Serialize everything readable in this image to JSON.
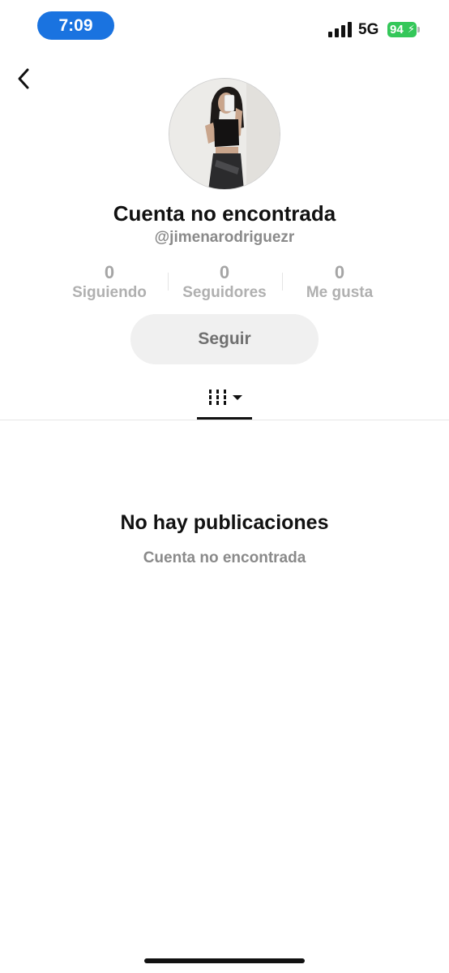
{
  "status_bar": {
    "time": "7:09",
    "network": "5G",
    "battery": "94",
    "accent_color": "#1a73e0",
    "battery_color": "#34c759"
  },
  "profile": {
    "title": "Cuenta no encontrada",
    "username": "@jimenarodriguezr",
    "stats": [
      {
        "value": "0",
        "label": "Siguiendo"
      },
      {
        "value": "0",
        "label": "Seguidores"
      },
      {
        "value": "0",
        "label": "Me gusta"
      }
    ],
    "follow_label": "Seguir"
  },
  "empty_state": {
    "title": "No hay publicaciones",
    "subtitle": "Cuenta no encontrada"
  },
  "icons": {
    "back": "chevron-left-icon",
    "tab": "videos-grid-icon",
    "dropdown": "caret-down-icon"
  }
}
